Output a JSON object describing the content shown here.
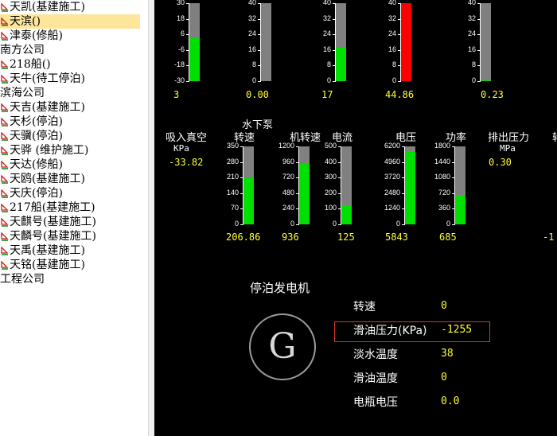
{
  "sidebar": {
    "items": [
      {
        "label": "天凯(基建施工)",
        "icon": "ship-icon",
        "selected": false
      },
      {
        "label": "天滨()",
        "icon": "ship-icon",
        "selected": true
      },
      {
        "label": "津泰(修船)",
        "icon": "ship-icon",
        "selected": false
      },
      {
        "label": "南方公司",
        "icon": "",
        "selected": false
      },
      {
        "label": "218船()",
        "icon": "ship-icon",
        "selected": false
      },
      {
        "label": "天牛(待工停泊)",
        "icon": "ship-icon",
        "selected": false
      },
      {
        "label": "滨海公司",
        "icon": "",
        "selected": false
      },
      {
        "label": "天吉(基建施工)",
        "icon": "ship-icon",
        "selected": false
      },
      {
        "label": "天杉(停泊)",
        "icon": "ship-icon",
        "selected": false
      },
      {
        "label": "天骥(停泊)",
        "icon": "ship-icon",
        "selected": false
      },
      {
        "label": "天骅 (维护施工)",
        "icon": "ship-icon",
        "selected": false
      },
      {
        "label": "天达(修船)",
        "icon": "ship-icon",
        "selected": false
      },
      {
        "label": "天鸥(基建施工)",
        "icon": "ship-icon",
        "selected": false
      },
      {
        "label": "天庆(停泊)",
        "icon": "ship-icon",
        "selected": false
      },
      {
        "label": "217船(基建施工)",
        "icon": "ship-icon",
        "selected": false
      },
      {
        "label": "天麒号(基建施工)",
        "icon": "ship-icon",
        "selected": false
      },
      {
        "label": "天麟号(基建施工)",
        "icon": "ship-icon",
        "selected": false
      },
      {
        "label": "天禹(基建施工)",
        "icon": "ship-icon",
        "selected": false
      },
      {
        "label": "天铭(基建施工)",
        "icon": "ship-icon",
        "selected": false
      },
      {
        "label": "工程公司",
        "icon": "",
        "selected": false
      }
    ]
  },
  "top_gauges": [
    {
      "ticks": [
        "30",
        "18",
        "6",
        "-6",
        "-18",
        "-30"
      ],
      "min": -30,
      "max": 30,
      "value": 3,
      "value_text": "3",
      "color": "#00e000"
    },
    {
      "ticks": [
        "40",
        "32",
        "24",
        "16",
        "8",
        "0"
      ],
      "min": 0,
      "max": 40,
      "value": 0,
      "value_text": "0.00",
      "color": "#00e000"
    },
    {
      "ticks": [
        "40",
        "32",
        "24",
        "16",
        "8",
        "0"
      ],
      "min": 0,
      "max": 40,
      "value": 17,
      "value_text": "17",
      "color": "#00e000"
    },
    {
      "ticks": [
        "40",
        "32",
        "24",
        "16",
        "8",
        "0"
      ],
      "min": 0,
      "max": 40,
      "value": 44.86,
      "value_text": "44.86",
      "color": "#ff0000"
    },
    {
      "ticks": [
        "40",
        "32",
        "24",
        "16",
        "8",
        "0"
      ],
      "min": 0,
      "max": 40,
      "value": 0.23,
      "value_text": "0.23",
      "color": "#00e000"
    }
  ],
  "pump": {
    "title": "水下泵",
    "suction": {
      "label": "吸入真空",
      "unit": "KPa",
      "value": "-33.82"
    },
    "discharge": {
      "label": "排出压力",
      "unit": "MPa",
      "value": "0.30"
    },
    "clipped_label": "转",
    "clipped_value": "-1",
    "gauges": [
      {
        "label": "转速",
        "ticks": [
          "350",
          "280",
          "210",
          "140",
          "70",
          "0"
        ],
        "min": 0,
        "max": 350,
        "value": 206.86,
        "value_text": "206.86",
        "color": "#00e000"
      },
      {
        "label": "机转速",
        "ticks": [
          "1200",
          "960",
          "720",
          "480",
          "240",
          "0"
        ],
        "min": 0,
        "max": 1200,
        "value": 936,
        "value_text": "936",
        "color": "#00e000"
      },
      {
        "label": "电流",
        "ticks": [
          "500",
          "400",
          "300",
          "200",
          "100",
          "0"
        ],
        "min": 0,
        "max": 500,
        "value": 125,
        "value_text": "125",
        "color": "#00e000"
      },
      {
        "label": "电压",
        "ticks": [
          "6200",
          "4960",
          "3720",
          "2480",
          "1240",
          "0"
        ],
        "min": 0,
        "max": 6200,
        "value": 5843,
        "value_text": "5843",
        "color": "#00e000"
      },
      {
        "label": "功率",
        "ticks": [
          "1800",
          "1440",
          "1080",
          "720",
          "360",
          "0"
        ],
        "min": 0,
        "max": 1800,
        "value": 685,
        "value_text": "685",
        "color": "#00e000"
      }
    ]
  },
  "generator": {
    "title": "停泊发电机",
    "symbol": "G",
    "rows": [
      {
        "label": "转速",
        "value": "0",
        "highlight": false
      },
      {
        "label": "滑油压力(KPa)",
        "value": "-1255",
        "highlight": true
      },
      {
        "label": "淡水温度",
        "value": "38",
        "highlight": false
      },
      {
        "label": "滑油温度",
        "value": "0",
        "highlight": false
      },
      {
        "label": "电瓶电压",
        "value": "0.0",
        "highlight": false
      }
    ]
  },
  "colors": {
    "accent_yellow": "#ffff33",
    "bar_green": "#00e000",
    "bar_alarm": "#ff0000",
    "bar_track": "#808080",
    "highlight_border": "#d9362a",
    "selection": "#fde59a"
  }
}
